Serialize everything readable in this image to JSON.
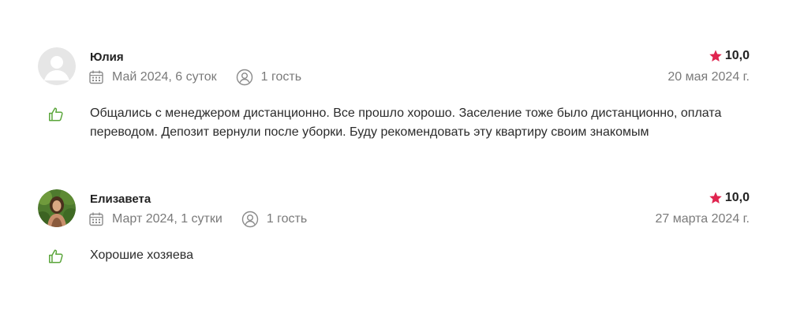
{
  "colors": {
    "star": "#e0244f",
    "like_icon": "#5aa53a",
    "meta_text": "#7a7a7a"
  },
  "reviews": [
    {
      "author": "Юлия",
      "stay": "Май 2024, 6 суток",
      "guests": "1 гость",
      "rating": "10,0",
      "date": "20 мая 2024 г.",
      "text": "Общались с менеджером дистанционно. Все прошло хорошо. Заселение тоже было дистанционно, оплата переводом. Депозит вернули после уборки. Буду рекомендовать эту квартиру своим знакомым",
      "avatar": "placeholder-avatar-icon"
    },
    {
      "author": "Елизавета",
      "stay": "Март 2024, 1 сутки",
      "guests": "1 гость",
      "rating": "10,0",
      "date": "27 марта 2024 г.",
      "text": "Хорошие хозяева",
      "avatar": "photo-avatar"
    }
  ]
}
